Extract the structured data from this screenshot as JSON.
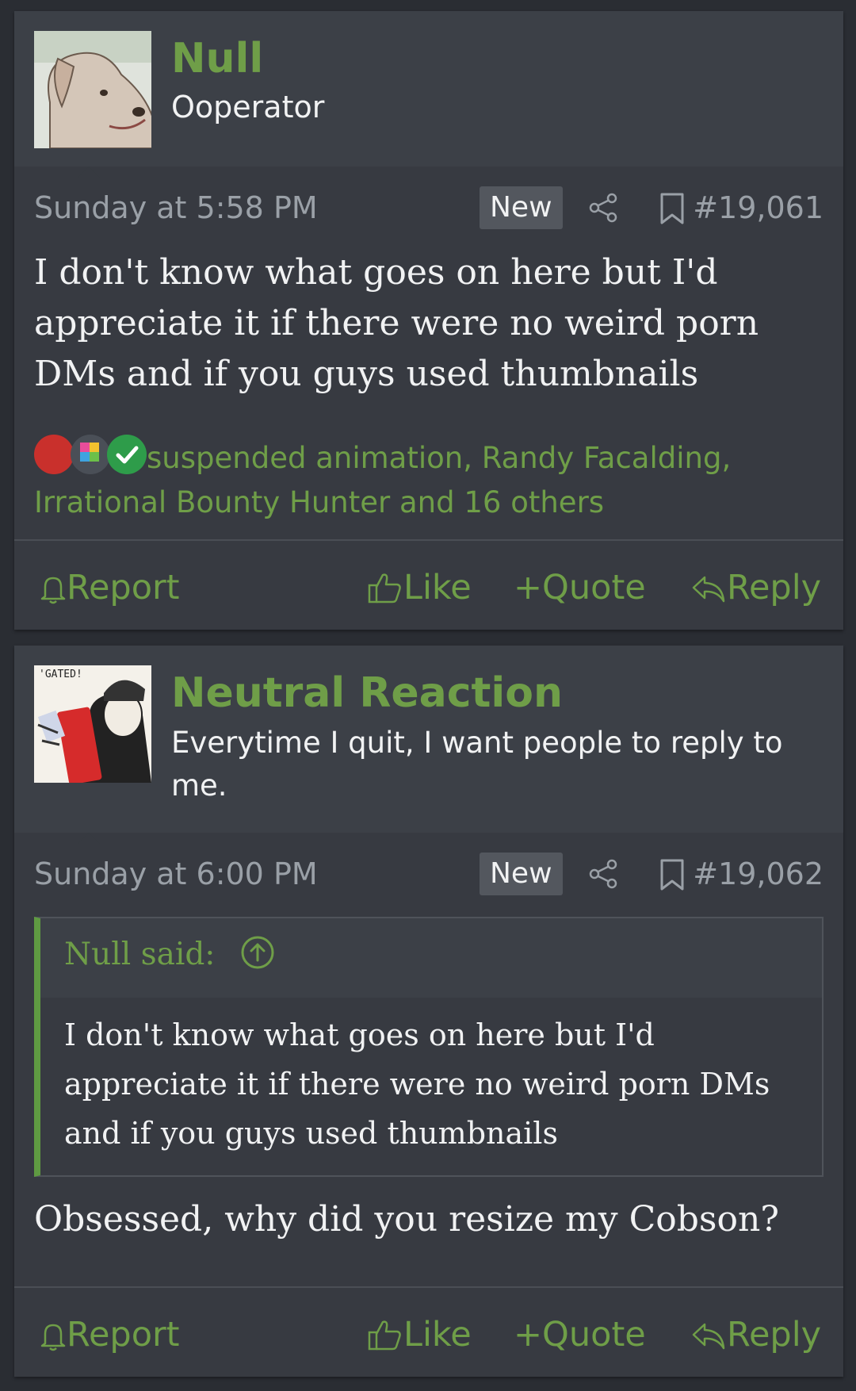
{
  "posts": [
    {
      "username": "Null",
      "user_title": "Ooperator",
      "date": "Sunday at 5:58 PM",
      "badge": "New",
      "post_number": "#19,061",
      "message": "I don't know what goes on here but I'd appreciate it if there were no weird porn DMs and if you guys used thumbnails",
      "reactions_text": "suspended animation, Randy Facalding, Irrational Bounty Hunter and 16 others",
      "avatar_icon": "dog-avatar-icon",
      "actions": {
        "report": "Report",
        "like": "Like",
        "quote": "Quote",
        "reply": "Reply"
      }
    },
    {
      "username": "Neutral Reaction",
      "user_title": "Everytime I quit, I want people to reply to me.",
      "date": "Sunday at 6:00 PM",
      "badge": "New",
      "post_number": "#19,062",
      "quote": {
        "attribution": "Null said:",
        "text": "I don't know what goes on here but I'd appreciate it if there were no weird porn DMs and if you guys used thumbnails"
      },
      "message": "Obsessed, why did you resize my Cobson?",
      "avatar_caption": "'GATED!",
      "avatar_icon": "cartoon-avatar-icon",
      "actions": {
        "report": "Report",
        "like": "Like",
        "quote": "Quote",
        "reply": "Reply"
      }
    }
  ],
  "colors": {
    "accent": "#6f9e48",
    "background": "#2a2d33",
    "card": "#373a41",
    "header": "#3c4047"
  }
}
